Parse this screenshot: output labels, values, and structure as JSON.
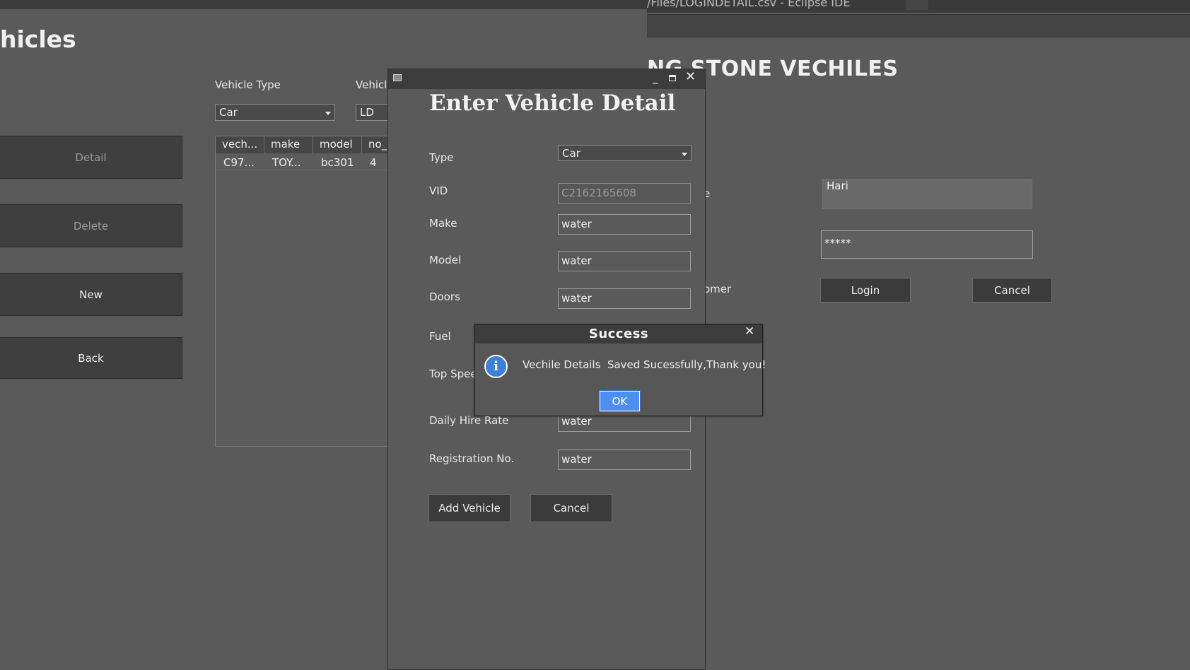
{
  "left_window": {
    "heading": "hicles",
    "vehicle_type_label": "Vehicle Type",
    "vehicle_label": "Vehicle",
    "vehicle_type_value": "Car",
    "vehicle_value": "LD",
    "buttons": {
      "detail": "Detail",
      "delete": "Delete",
      "new": "New",
      "back": "Back"
    },
    "table": {
      "columns": [
        "vech...",
        "make",
        "model",
        "no_"
      ],
      "rows": [
        [
          "C97...",
          "TOY...",
          "bc301",
          "4"
        ]
      ]
    }
  },
  "right_window": {
    "title": "/Files/LOGINDETAIL.csv - Eclipse IDE",
    "heading": "NG STONE VECHILES",
    "label_partial_1": "e",
    "label_partial_2": "omer",
    "username_value": "Hari",
    "password_value": "*****",
    "login_label": "Login",
    "cancel_label": "Cancel"
  },
  "vehicle_dialog": {
    "heading": "Enter Vehicle Detail",
    "fields": {
      "type": {
        "label": "Type",
        "value": "Car"
      },
      "vid": {
        "label": "VID",
        "value": "C2162165608"
      },
      "make": {
        "label": "Make",
        "value": "water"
      },
      "model": {
        "label": "Model",
        "value": "water"
      },
      "doors": {
        "label": "Doors",
        "value": "water"
      },
      "fuel": {
        "label": "Fuel"
      },
      "top_speed": {
        "label": "Top Spee"
      },
      "daily_hire_rate": {
        "label": "Daily Hire Rate",
        "value": "water"
      },
      "registration_no": {
        "label": "Registration No.",
        "value": "water"
      }
    },
    "add_vehicle_label": "Add Vehicle",
    "cancel_label": "Cancel",
    "icons": {
      "minimize": "minimize-icon",
      "maximize": "maximize-icon",
      "close": "close-icon"
    }
  },
  "success_dialog": {
    "title": "Success",
    "message": "Vechile Details  Saved Sucessfully,Thank you!",
    "ok_label": "OK",
    "icon": "info-icon",
    "icon_glyph": "i",
    "close_glyph": "✕",
    "accent_color": "#4d8ff0"
  }
}
